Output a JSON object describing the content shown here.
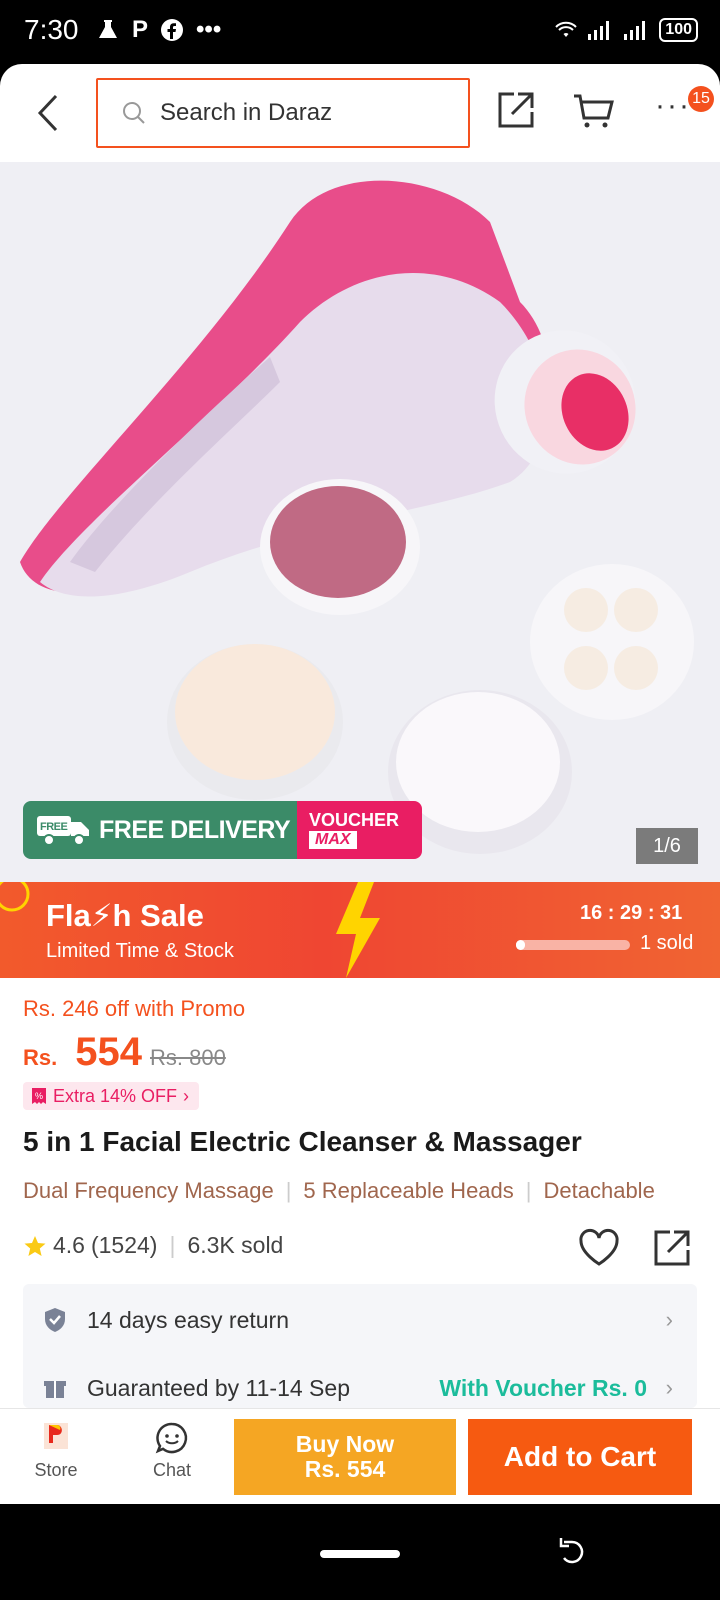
{
  "status_bar": {
    "time": "7:30",
    "app_icons": [
      "P"
    ],
    "more": "•••",
    "battery": "100"
  },
  "app_bar": {
    "search_placeholder": "Search in Daraz",
    "cart_badge": "15"
  },
  "hero": {
    "page_indicator": "1/6",
    "delivery_label": "FREE DELIVERY",
    "free_tag": "FREE",
    "voucher_label": "VOUCHER",
    "voucher_max": "MAX"
  },
  "flash_sale": {
    "title": "Fla⚡h Sale",
    "subtitle": "Limited Time & Stock",
    "timer": "16 : 29 : 31",
    "sold": "1 sold",
    "sold_progress": 0.08
  },
  "product": {
    "promo": "Rs. 246 off with Promo",
    "currency": "Rs.",
    "price": "554",
    "old_price": "Rs. 800",
    "extra_offer": "Extra 14% OFF",
    "title": "5 in 1 Facial Electric Cleanser & Massager",
    "features": [
      "Dual Frequency Massage",
      "5 Replaceable Heads",
      "Detachable"
    ],
    "rating": "4.6",
    "reviews": "(1524)",
    "sold": "6.3K sold"
  },
  "services": [
    {
      "label": "14 days easy return"
    },
    {
      "label": "Guaranteed by 11-14 Sep",
      "extra": "With Voucher Rs. 0"
    }
  ],
  "bottom_bar": {
    "store_label": "Store",
    "chat_label": "Chat",
    "buy_now_label": "Buy Now",
    "buy_now_price": "Rs. 554",
    "add_to_cart_label": "Add to Cart"
  },
  "colors": {
    "accent": "#f4511e",
    "buy_now": "#f5a623",
    "add_to_cart": "#f65a11",
    "voucher_green": "#1bbc9b"
  }
}
